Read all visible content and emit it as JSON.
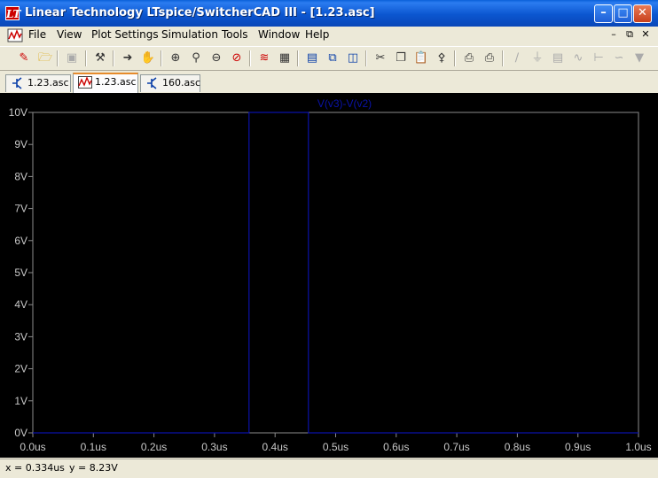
{
  "window": {
    "app_icon": "ltspice-logo-icon",
    "title": "Linear Technology LTspice/SwitcherCAD III - [1.23.asc]"
  },
  "menu": [
    "File",
    "View",
    "Plot Settings",
    "Simulation",
    "Tools",
    "Window",
    "Help"
  ],
  "toolbar": {
    "icons": [
      "new-schematic-icon",
      "open-icon",
      "save-icon",
      "control-panel-icon",
      "run-icon",
      "pan-hand-icon",
      "zoom-in-icon",
      "zoom-area-icon",
      "zoom-out-icon",
      "zoom-cancel-icon",
      "autorange-icon",
      "fit-icon",
      "tile-horizontal-icon",
      "cascade-icon",
      "tile-vertical-icon",
      "cut-icon",
      "copy-icon",
      "paste-icon",
      "find-icon",
      "print-preview-icon",
      "print-icon",
      "draw-wire-icon",
      "ground-icon",
      "label-icon",
      "resistor-icon",
      "capacitor-icon",
      "inductor-icon",
      "diode-icon"
    ]
  },
  "tabs": [
    {
      "label": "1.23.asc",
      "icon": "schematic-icon"
    },
    {
      "label": "1.23.asc",
      "icon": "waveform-icon",
      "active": true
    },
    {
      "label": "160.asc",
      "icon": "schematic-icon"
    }
  ],
  "status": {
    "x": "x = 0.334us",
    "y": "y = 8.23V"
  },
  "chart_data": {
    "type": "line",
    "series": [
      {
        "name": "V(v3)-V(v2)",
        "color": "#0a12a8",
        "x": [
          0.0,
          0.357,
          0.357,
          0.455,
          0.455,
          1.0
        ],
        "y": [
          0,
          0,
          10,
          10,
          0,
          0
        ]
      }
    ],
    "x_ticks": [
      "0.0us",
      "0.1us",
      "0.2us",
      "0.3us",
      "0.4us",
      "0.5us",
      "0.6us",
      "0.7us",
      "0.8us",
      "0.9us",
      "1.0us"
    ],
    "y_ticks": [
      "0V",
      "1V",
      "2V",
      "3V",
      "4V",
      "5V",
      "6V",
      "7V",
      "8V",
      "9V",
      "10V"
    ],
    "xlim": [
      0,
      1.0
    ],
    "ylim": [
      0,
      10
    ],
    "background": "#000000",
    "axis_color": "#8c8c8c",
    "label_color": "#c8c8c8",
    "grid": false
  }
}
